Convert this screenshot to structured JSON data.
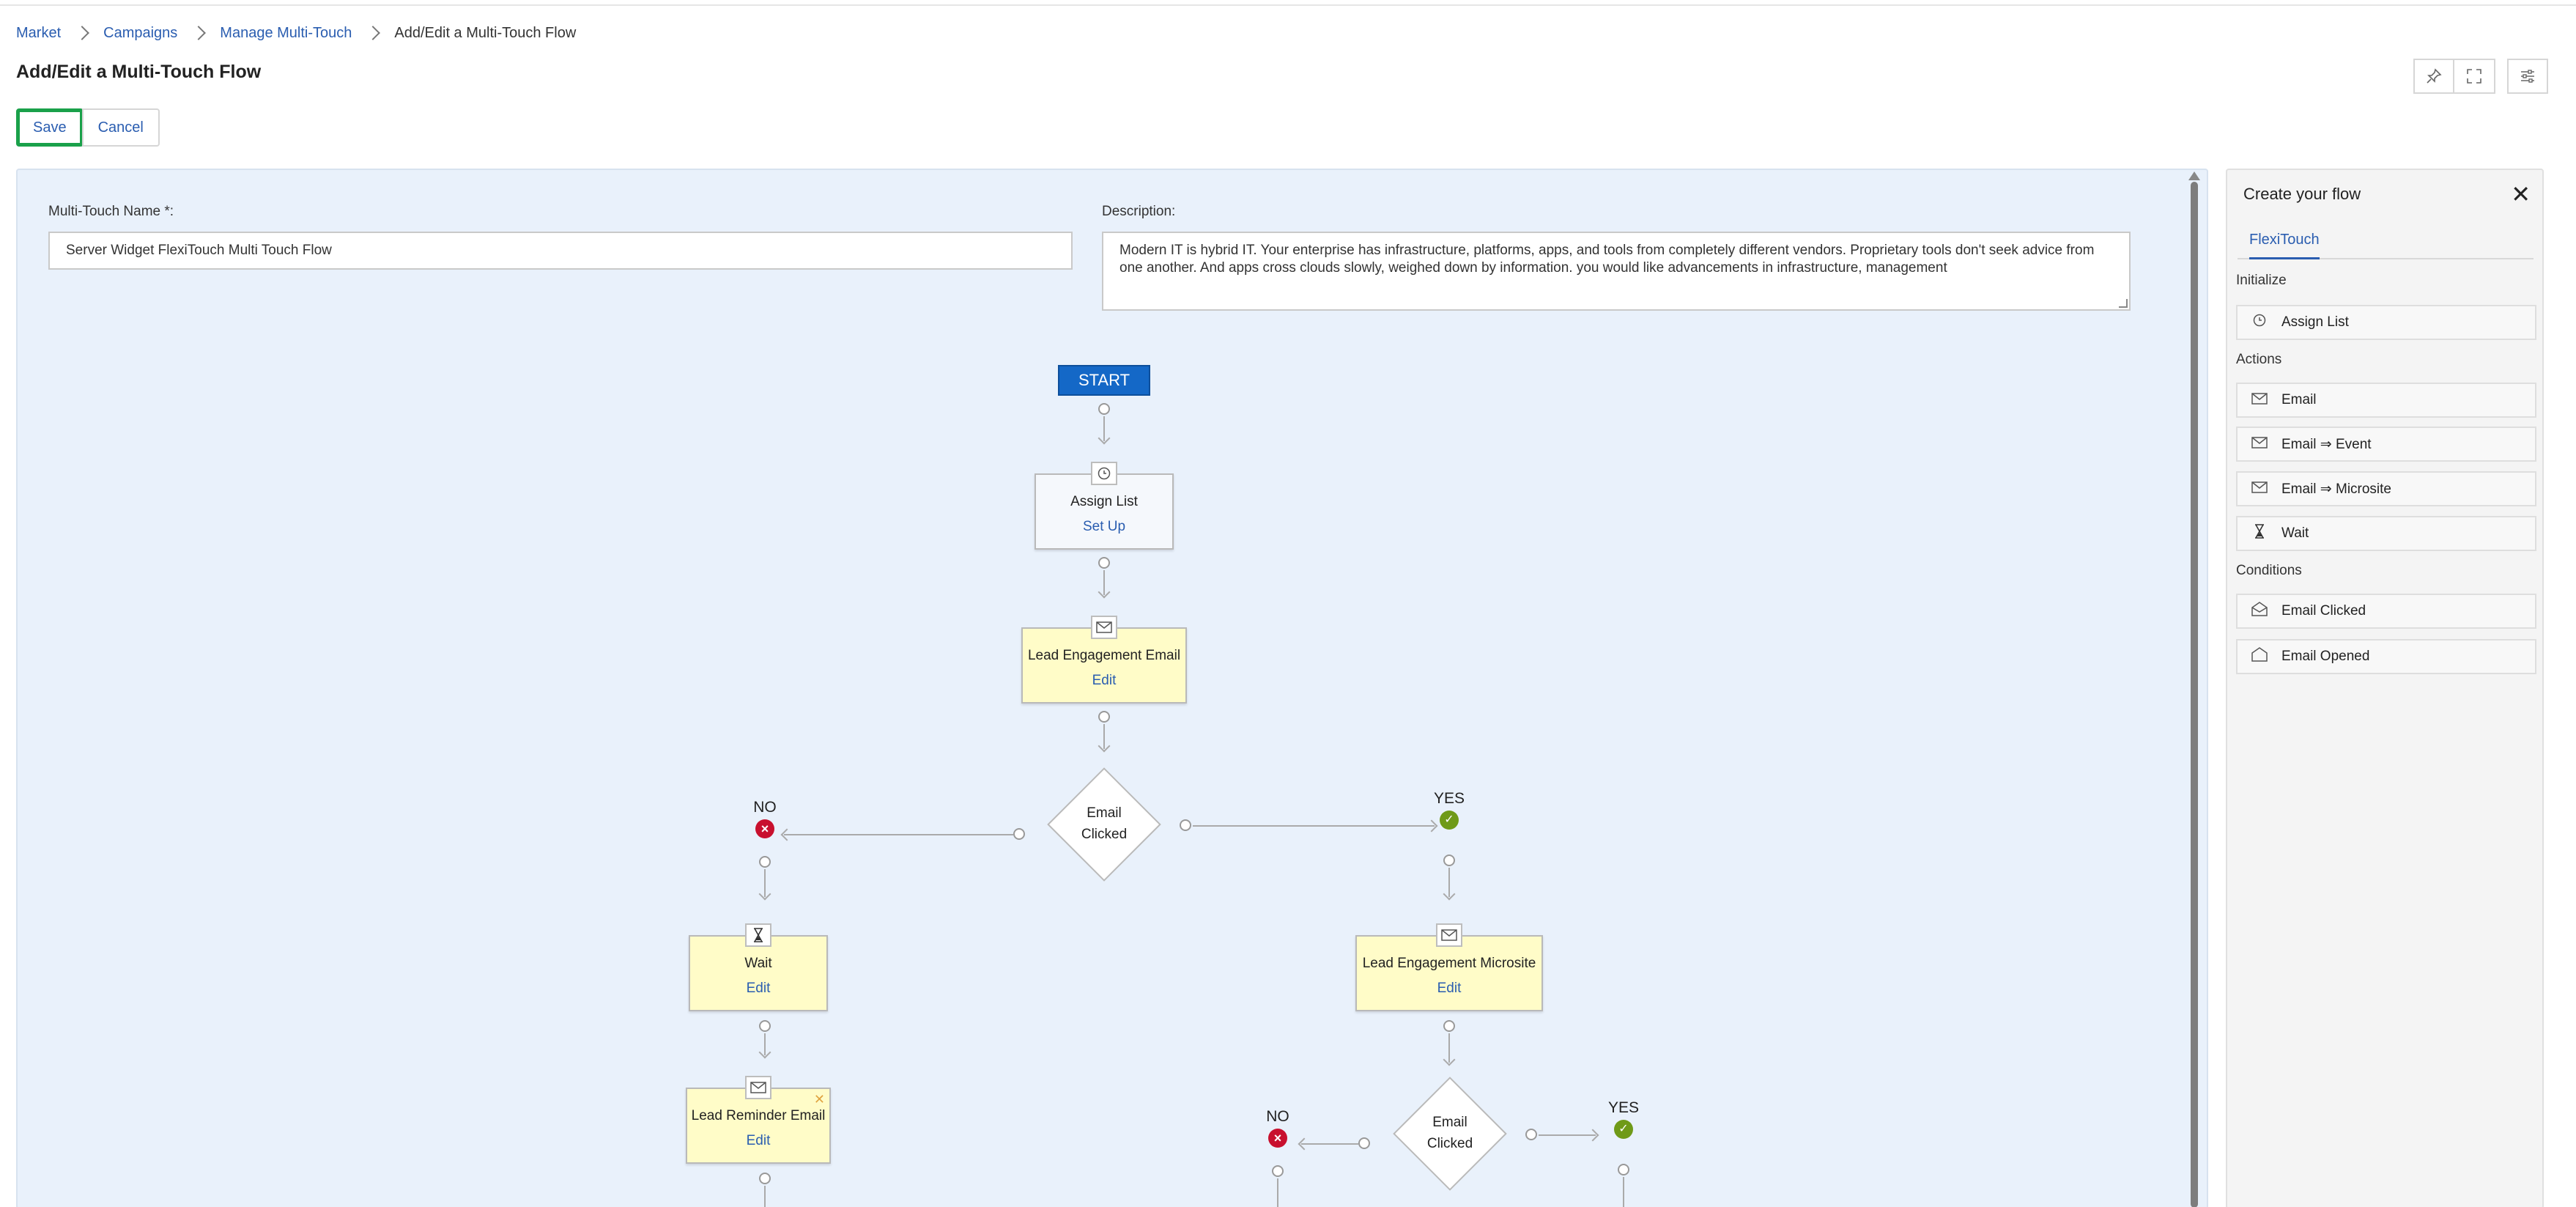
{
  "breadcrumb": {
    "items": [
      "Market",
      "Campaigns",
      "Manage Multi-Touch"
    ],
    "current": "Add/Edit a Multi-Touch Flow"
  },
  "page": {
    "title": "Add/Edit a Multi-Touch Flow"
  },
  "toolbar": {
    "save_label": "Save",
    "cancel_label": "Cancel"
  },
  "form": {
    "name_label": "Multi-Touch Name *:",
    "name_value": "Server Widget FlexiTouch Multi Touch Flow",
    "description_label": "Description:",
    "description_value": "Modern IT is hybrid IT. Your enterprise has infrastructure, platforms, apps, and tools from completely different vendors. Proprietary tools don't seek advice from one another. And apps cross clouds slowly, weighed down by information. you would like advancements in infrastructure, management"
  },
  "flow": {
    "start_label": "START",
    "assign_list": {
      "title": "Assign List",
      "link": "Set Up"
    },
    "lead_engagement_email": {
      "title": "Lead Engagement Email",
      "link": "Edit"
    },
    "condition_1": {
      "line1": "Email",
      "line2": "Clicked"
    },
    "no_label": "NO",
    "yes_label": "YES",
    "wait": {
      "title": "Wait",
      "link": "Edit"
    },
    "lead_reminder_email": {
      "title": "Lead Reminder Email",
      "link": "Edit"
    },
    "lead_engagement_microsite": {
      "title": "Lead Engagement Microsite",
      "link": "Edit"
    },
    "condition_2": {
      "line1": "Email",
      "line2": "Clicked"
    }
  },
  "panel": {
    "title": "Create your flow",
    "tab": "FlexiTouch",
    "sections": {
      "initialize": "Initialize",
      "actions": "Actions",
      "conditions": "Conditions"
    },
    "items": {
      "assign_list": "Assign List",
      "email": "Email",
      "email_event": "Email ⇒ Event",
      "email_microsite": "Email ⇒ Microsite",
      "wait": "Wait",
      "email_clicked": "Email Clicked",
      "email_opened": "Email Opened"
    }
  },
  "colors": {
    "accent": "#2a5db0",
    "start": "#1468c7",
    "node_fill": "#fffcc8",
    "canvas": "#e9f1fb",
    "save_outline": "#1aa14a",
    "no_badge": "#c8102e",
    "yes_badge": "#6f9a18"
  }
}
